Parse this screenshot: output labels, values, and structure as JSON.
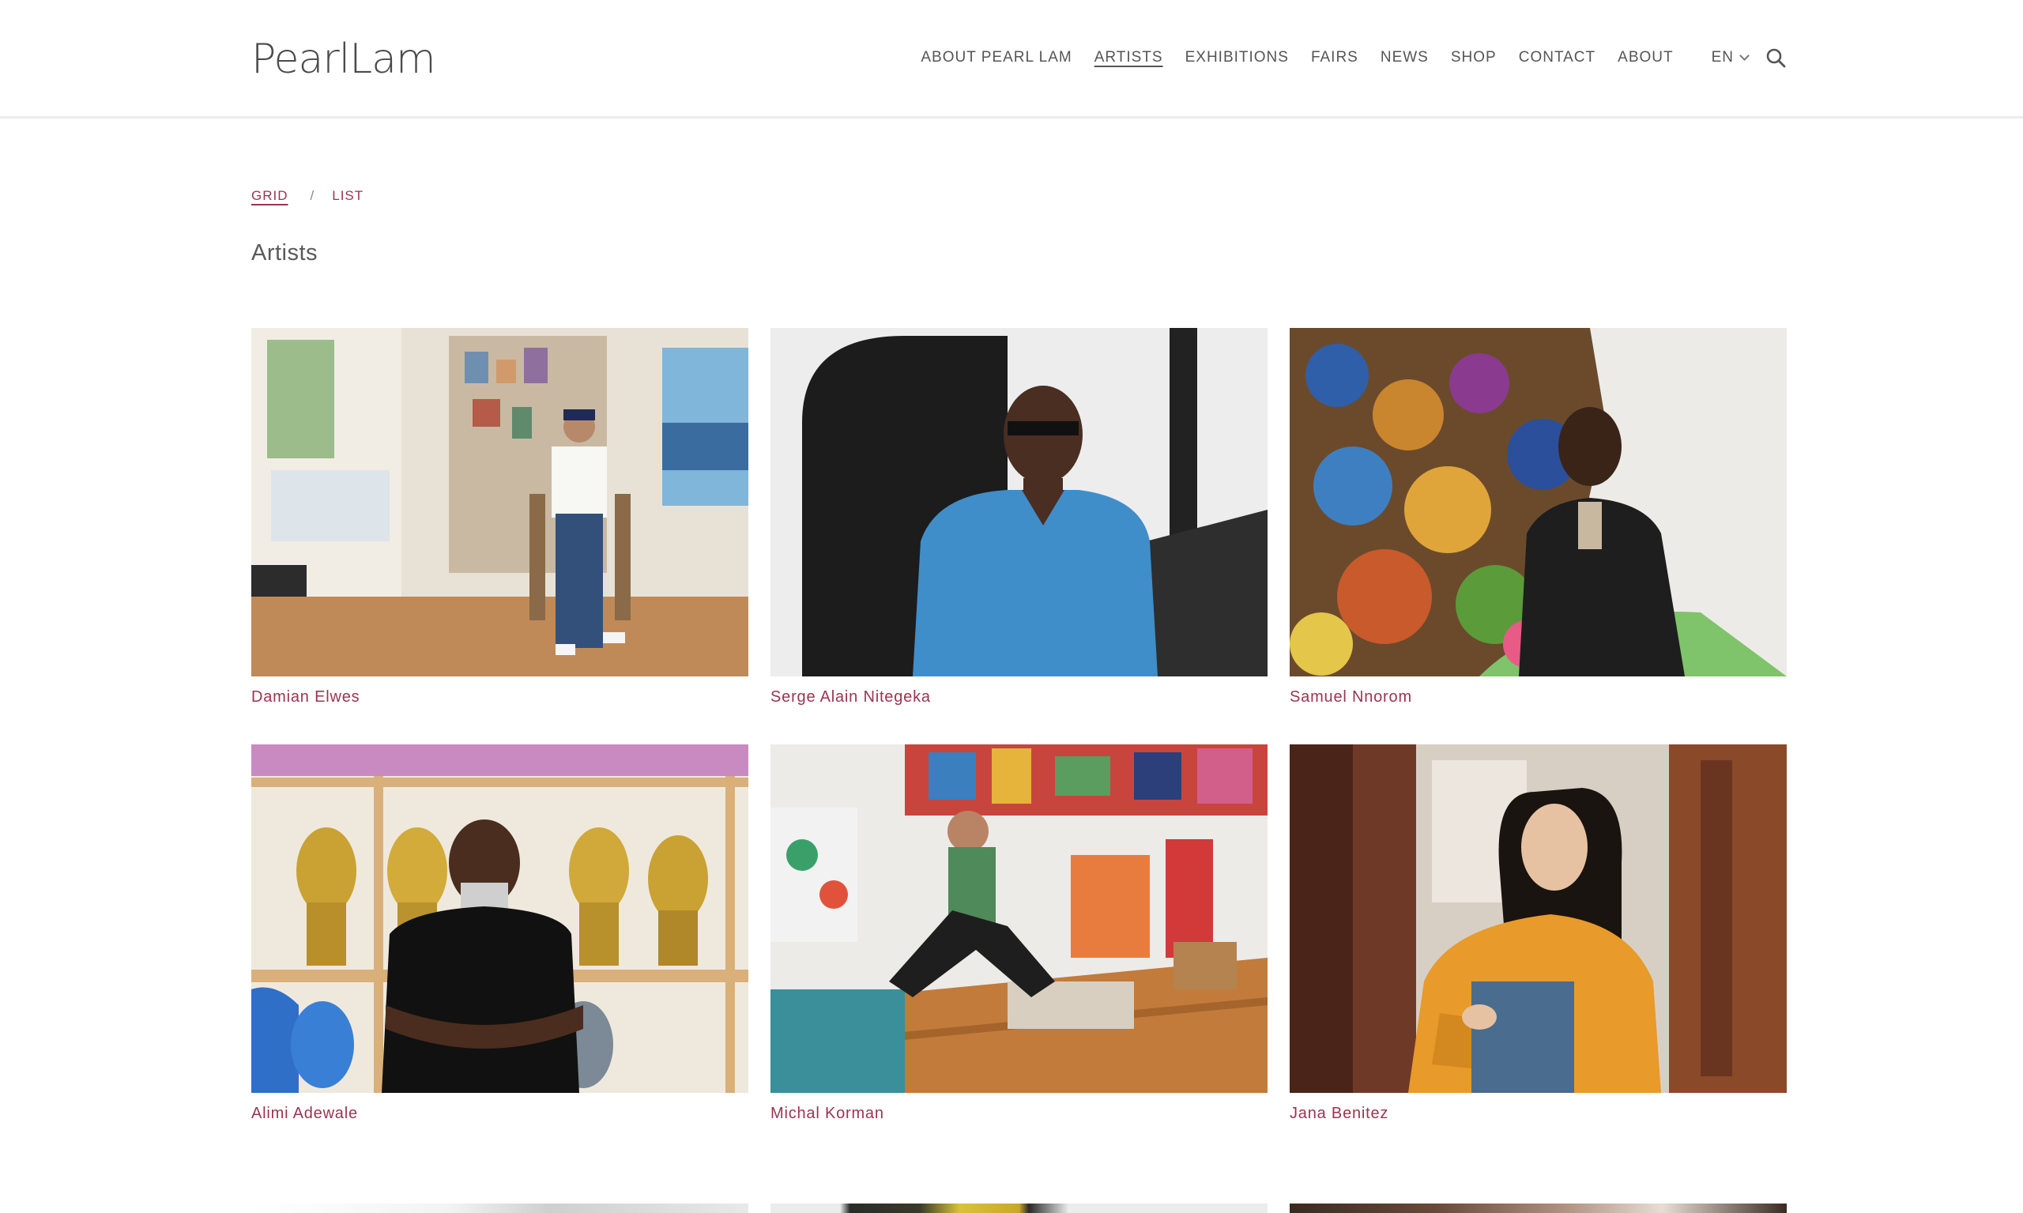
{
  "brand": {
    "logo": "PearlLam"
  },
  "nav": {
    "items": [
      {
        "label": "ABOUT PEARL LAM",
        "active": false
      },
      {
        "label": "ARTISTS",
        "active": true
      },
      {
        "label": "EXHIBITIONS",
        "active": false
      },
      {
        "label": "FAIRS",
        "active": false
      },
      {
        "label": "NEWS",
        "active": false
      },
      {
        "label": "SHOP",
        "active": false
      },
      {
        "label": "CONTACT",
        "active": false
      },
      {
        "label": "ABOUT",
        "active": false
      }
    ],
    "language": "EN",
    "search_icon": "search-icon",
    "chevron_icon": "chevron-down-icon"
  },
  "view_toggle": {
    "grid_label": "GRID",
    "separator": "/",
    "list_label": "LIST",
    "active": "grid"
  },
  "page_title": "Artists",
  "artists": [
    {
      "name": "Damian Elwes"
    },
    {
      "name": "Serge Alain Nitegeka"
    },
    {
      "name": "Samuel Nnorom"
    },
    {
      "name": "Alimi Adewale"
    },
    {
      "name": "Michal Korman"
    },
    {
      "name": "Jana Benitez"
    }
  ],
  "colors": {
    "accent": "#9b3450",
    "nav_text": "#555555",
    "title_text": "#5a5a5a",
    "divider": "#ececec"
  }
}
